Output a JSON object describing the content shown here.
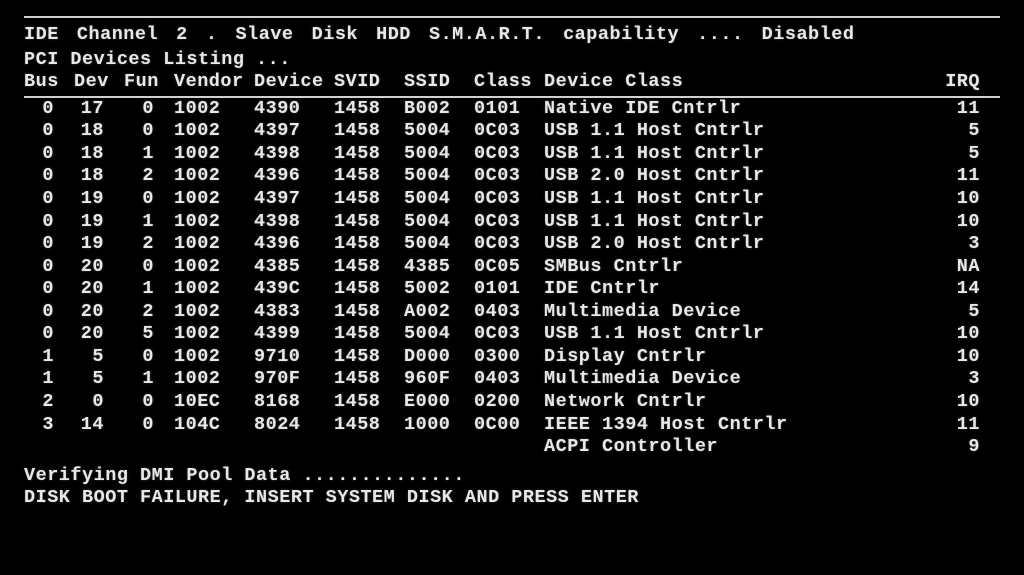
{
  "top_line": "IDE Channel 2 . Slave  Disk  HDD S.M.A.R.T. capability .... Disabled",
  "section_title": "PCI Devices Listing ...",
  "headers": {
    "bus": "Bus",
    "dev": "Dev",
    "fun": "Fun",
    "vendor": "Vendor",
    "device": "Device",
    "svid": "SVID",
    "ssid": "SSID",
    "class": "Class",
    "device_class": "Device Class",
    "irq": "IRQ"
  },
  "rows": [
    {
      "bus": "0",
      "dev": "17",
      "fun": "0",
      "vendor": "1002",
      "device": "4390",
      "svid": "1458",
      "ssid": "B002",
      "class": "0101",
      "dclass": "Native IDE Cntrlr",
      "irq": "11"
    },
    {
      "bus": "0",
      "dev": "18",
      "fun": "0",
      "vendor": "1002",
      "device": "4397",
      "svid": "1458",
      "ssid": "5004",
      "class": "0C03",
      "dclass": "USB 1.1 Host Cntrlr",
      "irq": "5"
    },
    {
      "bus": "0",
      "dev": "18",
      "fun": "1",
      "vendor": "1002",
      "device": "4398",
      "svid": "1458",
      "ssid": "5004",
      "class": "0C03",
      "dclass": "USB 1.1 Host Cntrlr",
      "irq": "5"
    },
    {
      "bus": "0",
      "dev": "18",
      "fun": "2",
      "vendor": "1002",
      "device": "4396",
      "svid": "1458",
      "ssid": "5004",
      "class": "0C03",
      "dclass": "USB 2.0 Host Cntrlr",
      "irq": "11"
    },
    {
      "bus": "0",
      "dev": "19",
      "fun": "0",
      "vendor": "1002",
      "device": "4397",
      "svid": "1458",
      "ssid": "5004",
      "class": "0C03",
      "dclass": "USB 1.1 Host Cntrlr",
      "irq": "10"
    },
    {
      "bus": "0",
      "dev": "19",
      "fun": "1",
      "vendor": "1002",
      "device": "4398",
      "svid": "1458",
      "ssid": "5004",
      "class": "0C03",
      "dclass": "USB 1.1 Host Cntrlr",
      "irq": "10"
    },
    {
      "bus": "0",
      "dev": "19",
      "fun": "2",
      "vendor": "1002",
      "device": "4396",
      "svid": "1458",
      "ssid": "5004",
      "class": "0C03",
      "dclass": "USB 2.0 Host Cntrlr",
      "irq": "3"
    },
    {
      "bus": "0",
      "dev": "20",
      "fun": "0",
      "vendor": "1002",
      "device": "4385",
      "svid": "1458",
      "ssid": "4385",
      "class": "0C05",
      "dclass": "SMBus Cntrlr",
      "irq": "NA"
    },
    {
      "bus": "0",
      "dev": "20",
      "fun": "1",
      "vendor": "1002",
      "device": "439C",
      "svid": "1458",
      "ssid": "5002",
      "class": "0101",
      "dclass": "IDE Cntrlr",
      "irq": "14"
    },
    {
      "bus": "0",
      "dev": "20",
      "fun": "2",
      "vendor": "1002",
      "device": "4383",
      "svid": "1458",
      "ssid": "A002",
      "class": "0403",
      "dclass": "Multimedia Device",
      "irq": "5"
    },
    {
      "bus": "0",
      "dev": "20",
      "fun": "5",
      "vendor": "1002",
      "device": "4399",
      "svid": "1458",
      "ssid": "5004",
      "class": "0C03",
      "dclass": "USB 1.1 Host Cntrlr",
      "irq": "10"
    },
    {
      "bus": "1",
      "dev": "5",
      "fun": "0",
      "vendor": "1002",
      "device": "9710",
      "svid": "1458",
      "ssid": "D000",
      "class": "0300",
      "dclass": "Display Cntrlr",
      "irq": "10"
    },
    {
      "bus": "1",
      "dev": "5",
      "fun": "1",
      "vendor": "1002",
      "device": "970F",
      "svid": "1458",
      "ssid": "960F",
      "class": "0403",
      "dclass": "Multimedia Device",
      "irq": "3"
    },
    {
      "bus": "2",
      "dev": "0",
      "fun": "0",
      "vendor": "10EC",
      "device": "8168",
      "svid": "1458",
      "ssid": "E000",
      "class": "0200",
      "dclass": "Network Cntrlr",
      "irq": "10"
    },
    {
      "bus": "3",
      "dev": "14",
      "fun": "0",
      "vendor": "104C",
      "device": "8024",
      "svid": "1458",
      "ssid": "1000",
      "class": "0C00",
      "dclass": "IEEE 1394 Host Cntrlr",
      "irq": "11"
    },
    {
      "bus": "",
      "dev": "",
      "fun": "",
      "vendor": "",
      "device": "",
      "svid": "",
      "ssid": "",
      "class": "",
      "dclass": "ACPI Controller",
      "irq": "9"
    }
  ],
  "footer": {
    "verify": "Verifying DMI Pool Data ..............",
    "error": "DISK BOOT FAILURE, INSERT SYSTEM DISK AND PRESS ENTER"
  }
}
